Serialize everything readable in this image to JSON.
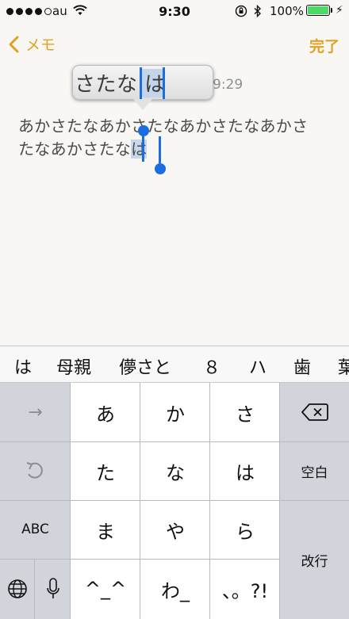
{
  "status": {
    "carrier": "au",
    "time": "9:30",
    "battery": "100%",
    "signal_bars_filled": 4,
    "signal_bars_total": 5,
    "battery_color": "#4cd964"
  },
  "nav": {
    "back_label": "メモ",
    "done_label": "完了",
    "accent_color": "#e0a224"
  },
  "note": {
    "date_partial": "9:29",
    "line1": "あかさたなあかさたなあかさたなあかさ",
    "line2_plain": "たなあかさたな",
    "line2_marked": "は"
  },
  "loupe": {
    "text": "さたな",
    "marked": "は"
  },
  "candidates": [
    "は",
    "母親",
    "儚さと",
    "８",
    "ハ",
    "歯",
    "葉"
  ],
  "keyboard": {
    "rows": [
      {
        "left": "→",
        "keys": [
          "あ",
          "か",
          "さ"
        ],
        "right": "⌫"
      },
      {
        "left": "↺",
        "keys": [
          "た",
          "な",
          "は"
        ],
        "right": "空白"
      },
      {
        "left": "ABC",
        "keys": [
          "ま",
          "や",
          "ら"
        ],
        "right": "改行"
      },
      {
        "left_globe": "globe-icon",
        "left_mic": "mic-icon",
        "keys": [
          "^_^",
          "わ_",
          "、。?!"
        ]
      }
    ]
  }
}
